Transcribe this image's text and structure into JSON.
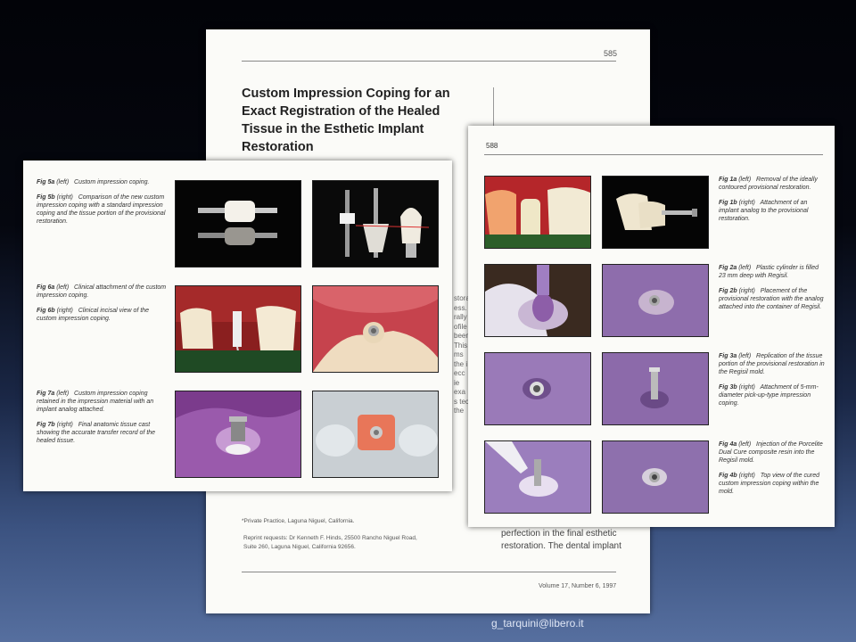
{
  "back_page": {
    "page_number": "585",
    "title": "Custom Impression Coping for an Exact Registration of the Healed Tissue in the Esthetic Implant Restoration",
    "fragments": [
      "storat",
      "ess. V",
      "rally",
      "ofile",
      "been",
      "This",
      "ms",
      "the i",
      "ecc",
      "ie",
      "exa",
      "s tec",
      "the"
    ],
    "footnote": "*Private Practice, Laguna Niguel, California.",
    "reprint_line1": "Reprint requests: Dr Kenneth F. Hinds, 25500 Rancho Niguel Road,",
    "reprint_line2": "Suite 260, Laguna Niguel, California 92656.",
    "body_line1": "perfection in the final esthetic",
    "body_line2": "restoration. The dental implant",
    "footer": "Volume 17, Number 6, 1997"
  },
  "left_page": {
    "captions": [
      {
        "label": "Fig 5a",
        "pos": "(left)",
        "text": "Custom impression coping."
      },
      {
        "label": "Fig 5b",
        "pos": "(right)",
        "text": "Comparison of the new custom impression coping with a standard impression coping and the tissue portion of the provisional restoration."
      },
      {
        "label": "Fig 6a",
        "pos": "(left)",
        "text": "Clinical attachment of the custom impression coping."
      },
      {
        "label": "Fig 6b",
        "pos": "(right)",
        "text": "Clinical incisal view of the custom impression coping."
      },
      {
        "label": "Fig 7a",
        "pos": "(left)",
        "text": "Custom impression coping retained in the impression material with an implant analog attached."
      },
      {
        "label": "Fig 7b",
        "pos": "(right)",
        "text": "Final anatomic tissue cast showing the accurate transfer record of the healed tissue."
      }
    ]
  },
  "right_page": {
    "page_number": "588",
    "captions": [
      {
        "label": "Fig 1a",
        "pos": "(left)",
        "text": "Removal of the ideally contoured provisional restoration."
      },
      {
        "label": "Fig 1b",
        "pos": "(right)",
        "text": "Attachment of an implant analog to the provisional restoration."
      },
      {
        "label": "Fig 2a",
        "pos": "(left)",
        "text": "Plastic cylinder is filled 23 mm deep with Regisil."
      },
      {
        "label": "Fig 2b",
        "pos": "(right)",
        "text": "Placement of the provisional restoration with the analog attached into the container of Regisil."
      },
      {
        "label": "Fig 3a",
        "pos": "(left)",
        "text": "Replication of the tissue portion of the provisional restoration in the Regisil mold."
      },
      {
        "label": "Fig 3b",
        "pos": "(right)",
        "text": "Attachment of 5-mm-diameter pick-up-type impression coping."
      },
      {
        "label": "Fig 4a",
        "pos": "(left)",
        "text": "Injection of the Porcelite Dual Cure composite resin into the Regisil mold."
      },
      {
        "label": "Fig 4b",
        "pos": "(right)",
        "text": "Top view of the cured custom impression coping within the mold."
      }
    ]
  },
  "credit": "g_tarquini@libero.it"
}
